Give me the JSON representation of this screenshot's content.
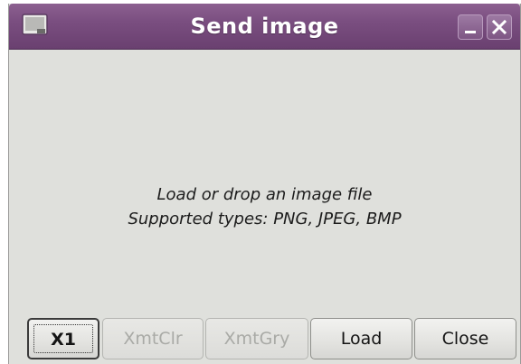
{
  "window": {
    "title": "Send image",
    "title_bar_color": "#7a4e80"
  },
  "icons": {
    "app": "window-app-icon",
    "minimize": "minimize-icon",
    "close": "close-icon"
  },
  "message": {
    "line1": "Load or drop an image file",
    "line2": "Supported types: PNG, JPEG, BMP"
  },
  "buttons": {
    "x1": {
      "label": "X1",
      "enabled": true,
      "focused": true
    },
    "xmtclr": {
      "label": "XmtClr",
      "enabled": false
    },
    "xmtgry": {
      "label": "XmtGry",
      "enabled": false
    },
    "load": {
      "label": "Load",
      "enabled": true
    },
    "close": {
      "label": "Close",
      "enabled": true
    }
  }
}
